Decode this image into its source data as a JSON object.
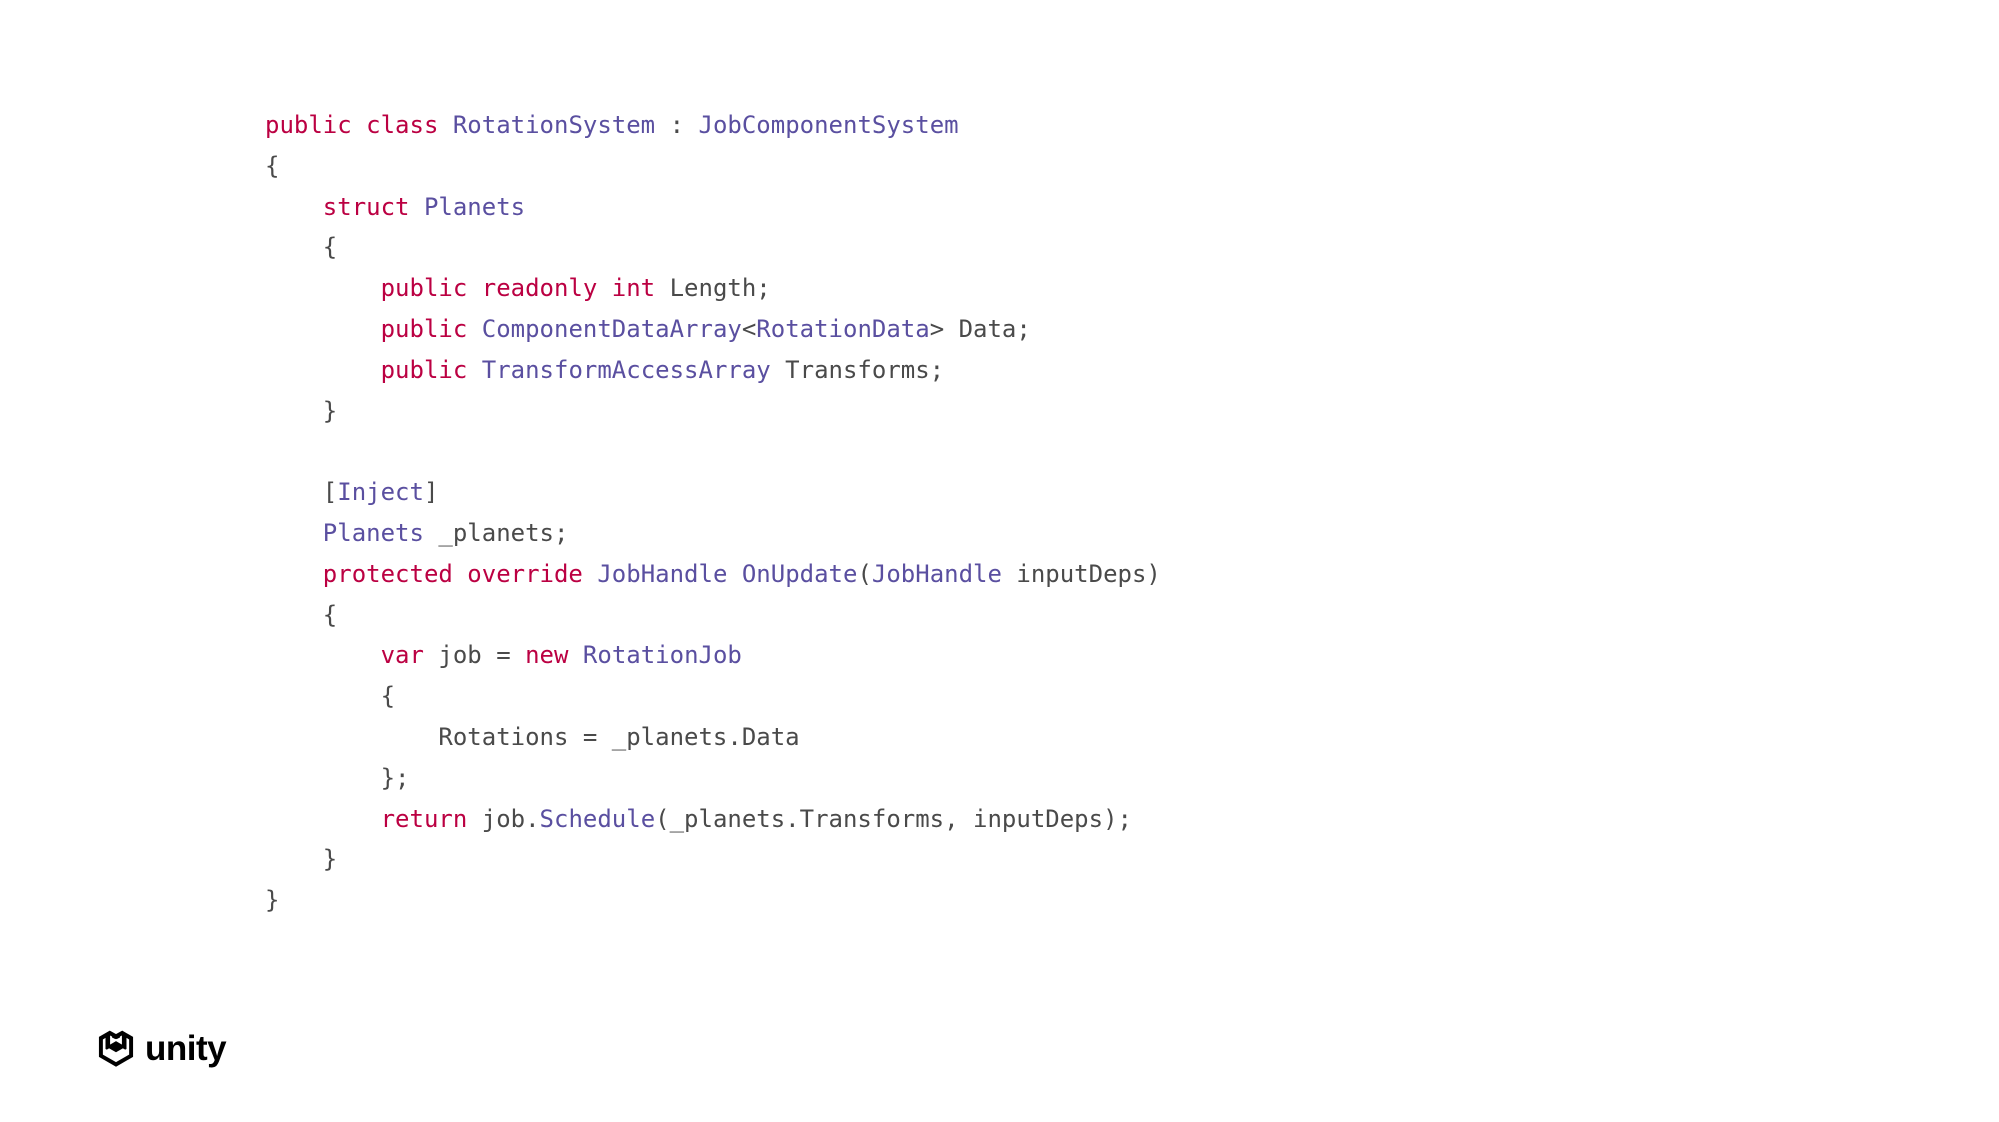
{
  "code": {
    "tokens": [
      [
        {
          "t": "public class",
          "c": "keyword"
        },
        {
          "t": " ",
          "c": "default"
        },
        {
          "t": "RotationSystem",
          "c": "type"
        },
        {
          "t": " : ",
          "c": "default"
        },
        {
          "t": "JobComponentSystem",
          "c": "type"
        }
      ],
      [
        {
          "t": "{",
          "c": "default"
        }
      ],
      [
        {
          "t": "    ",
          "c": "default"
        },
        {
          "t": "struct",
          "c": "keyword"
        },
        {
          "t": " ",
          "c": "default"
        },
        {
          "t": "Planets",
          "c": "type"
        }
      ],
      [
        {
          "t": "    {",
          "c": "default"
        }
      ],
      [
        {
          "t": "        ",
          "c": "default"
        },
        {
          "t": "public readonly int",
          "c": "keyword"
        },
        {
          "t": " Length;",
          "c": "default"
        }
      ],
      [
        {
          "t": "        ",
          "c": "default"
        },
        {
          "t": "public",
          "c": "keyword"
        },
        {
          "t": " ",
          "c": "default"
        },
        {
          "t": "ComponentDataArray",
          "c": "type"
        },
        {
          "t": "<",
          "c": "default"
        },
        {
          "t": "RotationData",
          "c": "type"
        },
        {
          "t": "> Data;",
          "c": "default"
        }
      ],
      [
        {
          "t": "        ",
          "c": "default"
        },
        {
          "t": "public",
          "c": "keyword"
        },
        {
          "t": " ",
          "c": "default"
        },
        {
          "t": "TransformAccessArray",
          "c": "type"
        },
        {
          "t": " Transforms;",
          "c": "default"
        }
      ],
      [
        {
          "t": "    }",
          "c": "default"
        }
      ],
      [
        {
          "t": "",
          "c": "default"
        }
      ],
      [
        {
          "t": "    [",
          "c": "default"
        },
        {
          "t": "Inject",
          "c": "type"
        },
        {
          "t": "]",
          "c": "default"
        }
      ],
      [
        {
          "t": "    ",
          "c": "default"
        },
        {
          "t": "Planets",
          "c": "type"
        },
        {
          "t": " _planets;",
          "c": "default"
        }
      ],
      [
        {
          "t": "    ",
          "c": "default"
        },
        {
          "t": "protected override",
          "c": "keyword"
        },
        {
          "t": " ",
          "c": "default"
        },
        {
          "t": "JobHandle",
          "c": "type"
        },
        {
          "t": " ",
          "c": "default"
        },
        {
          "t": "OnUpdate",
          "c": "method"
        },
        {
          "t": "(",
          "c": "default"
        },
        {
          "t": "JobHandle",
          "c": "type"
        },
        {
          "t": " inputDeps)",
          "c": "default"
        }
      ],
      [
        {
          "t": "    {",
          "c": "default"
        }
      ],
      [
        {
          "t": "        ",
          "c": "default"
        },
        {
          "t": "var",
          "c": "keyword"
        },
        {
          "t": " job = ",
          "c": "default"
        },
        {
          "t": "new",
          "c": "keyword"
        },
        {
          "t": " ",
          "c": "default"
        },
        {
          "t": "RotationJob",
          "c": "type"
        }
      ],
      [
        {
          "t": "        {",
          "c": "default"
        }
      ],
      [
        {
          "t": "            Rotations = _planets.Data",
          "c": "default"
        }
      ],
      [
        {
          "t": "        };",
          "c": "default"
        }
      ],
      [
        {
          "t": "        ",
          "c": "default"
        },
        {
          "t": "return",
          "c": "keyword"
        },
        {
          "t": " job.",
          "c": "default"
        },
        {
          "t": "Schedule",
          "c": "method"
        },
        {
          "t": "(_planets.Transforms, inputDeps);",
          "c": "default"
        }
      ],
      [
        {
          "t": "    }",
          "c": "default"
        }
      ],
      [
        {
          "t": "}",
          "c": "default"
        }
      ]
    ]
  },
  "logo": {
    "text": "unity"
  }
}
